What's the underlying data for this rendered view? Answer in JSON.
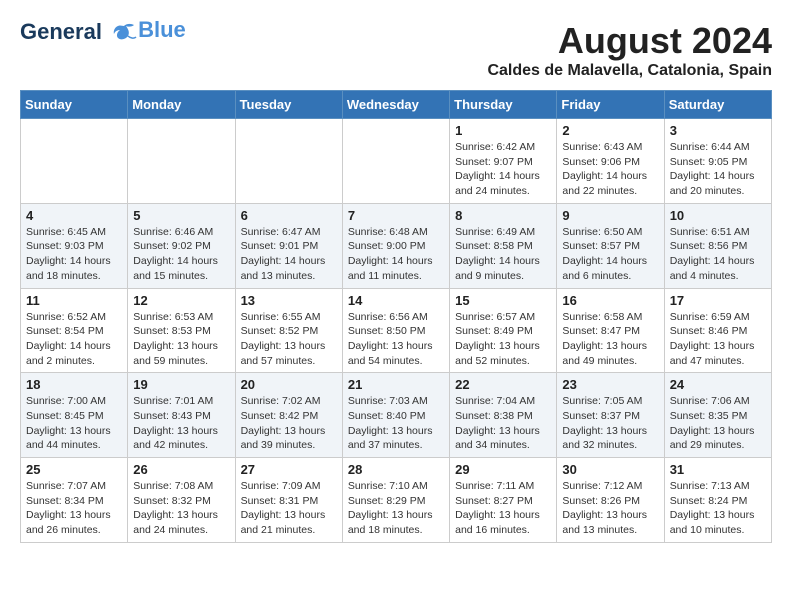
{
  "logo": {
    "line1": "General",
    "line2": "Blue"
  },
  "title": "August 2024",
  "subtitle": "Caldes de Malavella, Catalonia, Spain",
  "days_of_week": [
    "Sunday",
    "Monday",
    "Tuesday",
    "Wednesday",
    "Thursday",
    "Friday",
    "Saturday"
  ],
  "weeks": [
    [
      {
        "day": "",
        "info": ""
      },
      {
        "day": "",
        "info": ""
      },
      {
        "day": "",
        "info": ""
      },
      {
        "day": "",
        "info": ""
      },
      {
        "day": "1",
        "info": "Sunrise: 6:42 AM\nSunset: 9:07 PM\nDaylight: 14 hours and 24 minutes."
      },
      {
        "day": "2",
        "info": "Sunrise: 6:43 AM\nSunset: 9:06 PM\nDaylight: 14 hours and 22 minutes."
      },
      {
        "day": "3",
        "info": "Sunrise: 6:44 AM\nSunset: 9:05 PM\nDaylight: 14 hours and 20 minutes."
      }
    ],
    [
      {
        "day": "4",
        "info": "Sunrise: 6:45 AM\nSunset: 9:03 PM\nDaylight: 14 hours and 18 minutes."
      },
      {
        "day": "5",
        "info": "Sunrise: 6:46 AM\nSunset: 9:02 PM\nDaylight: 14 hours and 15 minutes."
      },
      {
        "day": "6",
        "info": "Sunrise: 6:47 AM\nSunset: 9:01 PM\nDaylight: 14 hours and 13 minutes."
      },
      {
        "day": "7",
        "info": "Sunrise: 6:48 AM\nSunset: 9:00 PM\nDaylight: 14 hours and 11 minutes."
      },
      {
        "day": "8",
        "info": "Sunrise: 6:49 AM\nSunset: 8:58 PM\nDaylight: 14 hours and 9 minutes."
      },
      {
        "day": "9",
        "info": "Sunrise: 6:50 AM\nSunset: 8:57 PM\nDaylight: 14 hours and 6 minutes."
      },
      {
        "day": "10",
        "info": "Sunrise: 6:51 AM\nSunset: 8:56 PM\nDaylight: 14 hours and 4 minutes."
      }
    ],
    [
      {
        "day": "11",
        "info": "Sunrise: 6:52 AM\nSunset: 8:54 PM\nDaylight: 14 hours and 2 minutes."
      },
      {
        "day": "12",
        "info": "Sunrise: 6:53 AM\nSunset: 8:53 PM\nDaylight: 13 hours and 59 minutes."
      },
      {
        "day": "13",
        "info": "Sunrise: 6:55 AM\nSunset: 8:52 PM\nDaylight: 13 hours and 57 minutes."
      },
      {
        "day": "14",
        "info": "Sunrise: 6:56 AM\nSunset: 8:50 PM\nDaylight: 13 hours and 54 minutes."
      },
      {
        "day": "15",
        "info": "Sunrise: 6:57 AM\nSunset: 8:49 PM\nDaylight: 13 hours and 52 minutes."
      },
      {
        "day": "16",
        "info": "Sunrise: 6:58 AM\nSunset: 8:47 PM\nDaylight: 13 hours and 49 minutes."
      },
      {
        "day": "17",
        "info": "Sunrise: 6:59 AM\nSunset: 8:46 PM\nDaylight: 13 hours and 47 minutes."
      }
    ],
    [
      {
        "day": "18",
        "info": "Sunrise: 7:00 AM\nSunset: 8:45 PM\nDaylight: 13 hours and 44 minutes."
      },
      {
        "day": "19",
        "info": "Sunrise: 7:01 AM\nSunset: 8:43 PM\nDaylight: 13 hours and 42 minutes."
      },
      {
        "day": "20",
        "info": "Sunrise: 7:02 AM\nSunset: 8:42 PM\nDaylight: 13 hours and 39 minutes."
      },
      {
        "day": "21",
        "info": "Sunrise: 7:03 AM\nSunset: 8:40 PM\nDaylight: 13 hours and 37 minutes."
      },
      {
        "day": "22",
        "info": "Sunrise: 7:04 AM\nSunset: 8:38 PM\nDaylight: 13 hours and 34 minutes."
      },
      {
        "day": "23",
        "info": "Sunrise: 7:05 AM\nSunset: 8:37 PM\nDaylight: 13 hours and 32 minutes."
      },
      {
        "day": "24",
        "info": "Sunrise: 7:06 AM\nSunset: 8:35 PM\nDaylight: 13 hours and 29 minutes."
      }
    ],
    [
      {
        "day": "25",
        "info": "Sunrise: 7:07 AM\nSunset: 8:34 PM\nDaylight: 13 hours and 26 minutes."
      },
      {
        "day": "26",
        "info": "Sunrise: 7:08 AM\nSunset: 8:32 PM\nDaylight: 13 hours and 24 minutes."
      },
      {
        "day": "27",
        "info": "Sunrise: 7:09 AM\nSunset: 8:31 PM\nDaylight: 13 hours and 21 minutes."
      },
      {
        "day": "28",
        "info": "Sunrise: 7:10 AM\nSunset: 8:29 PM\nDaylight: 13 hours and 18 minutes."
      },
      {
        "day": "29",
        "info": "Sunrise: 7:11 AM\nSunset: 8:27 PM\nDaylight: 13 hours and 16 minutes."
      },
      {
        "day": "30",
        "info": "Sunrise: 7:12 AM\nSunset: 8:26 PM\nDaylight: 13 hours and 13 minutes."
      },
      {
        "day": "31",
        "info": "Sunrise: 7:13 AM\nSunset: 8:24 PM\nDaylight: 13 hours and 10 minutes."
      }
    ]
  ]
}
